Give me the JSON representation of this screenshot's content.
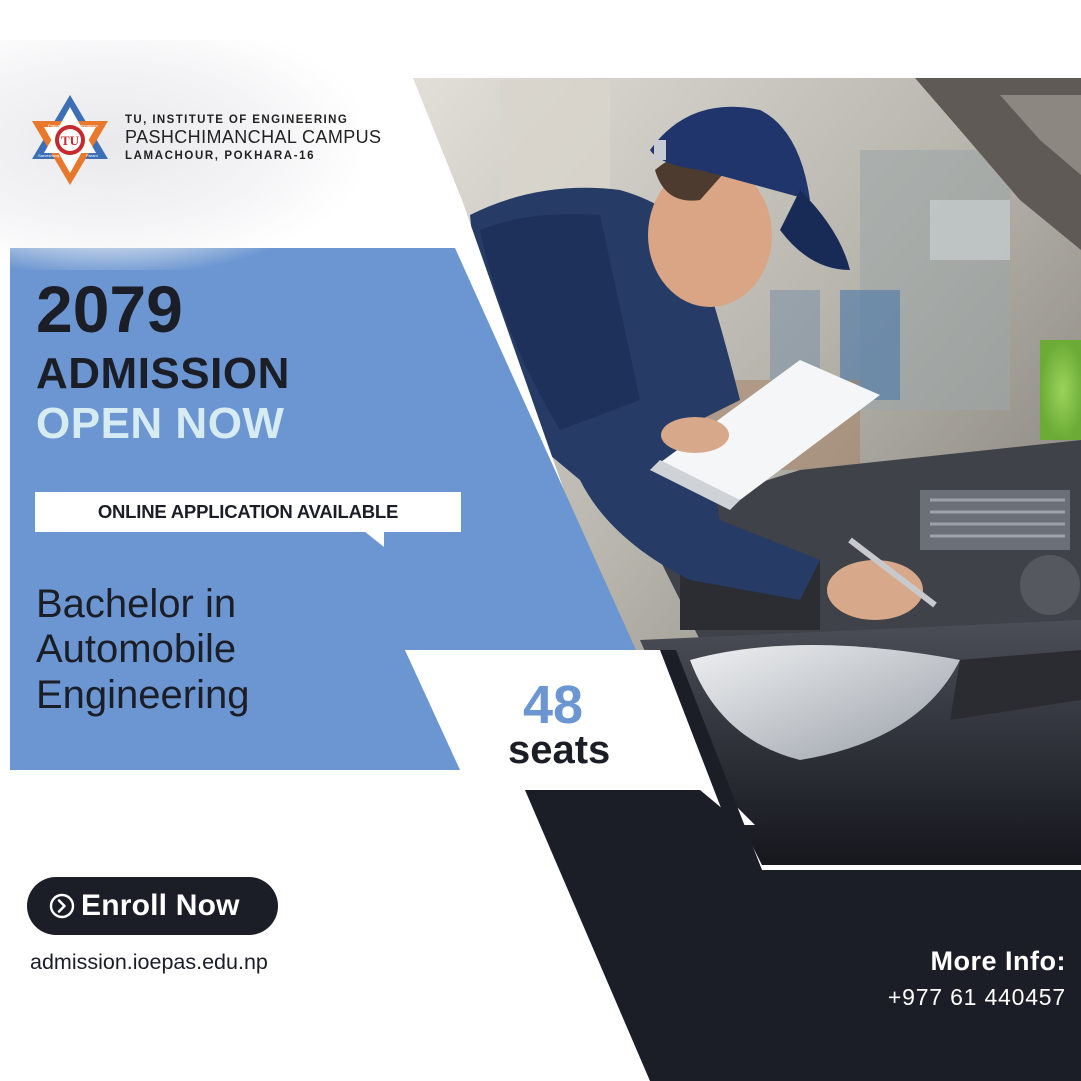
{
  "header": {
    "institute_line1": "TU, INSTITUTE OF ENGINEERING",
    "campus_name": "PASHCHIMANCHAL CAMPUS",
    "address": "LAMACHOUR, POKHARA-16",
    "logo_text": {
      "top_left": "Prajnam",
      "top_right": "Brahmanam",
      "center": "TU",
      "bottom_left": "Sarveshang",
      "bottom_right": "Param"
    }
  },
  "headline": {
    "year": "2079",
    "admission": "ADMISSION",
    "open_now": "OPEN NOW"
  },
  "online_notice": "ONLINE APPLICATION AVAILABLE",
  "program": {
    "line1": "Bachelor in",
    "line2": "Automobile",
    "line3": "Engineering"
  },
  "seats": {
    "count": "48",
    "label": "seats"
  },
  "enroll": {
    "button_label": "Enroll Now",
    "icon": "arrow-circle-right-icon"
  },
  "website": "admission.ioepas.edu.np",
  "contact": {
    "heading": "More Info:",
    "phone": "+977 61 440457"
  },
  "colors": {
    "navy": "#1c1e27",
    "blue_panel": "#6b96d1",
    "light_cyan": "#d7ecf2",
    "logo_orange": "#e8782c",
    "logo_blue": "#3c6fb6",
    "logo_red": "#c62a2f"
  },
  "photo": {
    "description_icon": "mechanic-photo"
  }
}
